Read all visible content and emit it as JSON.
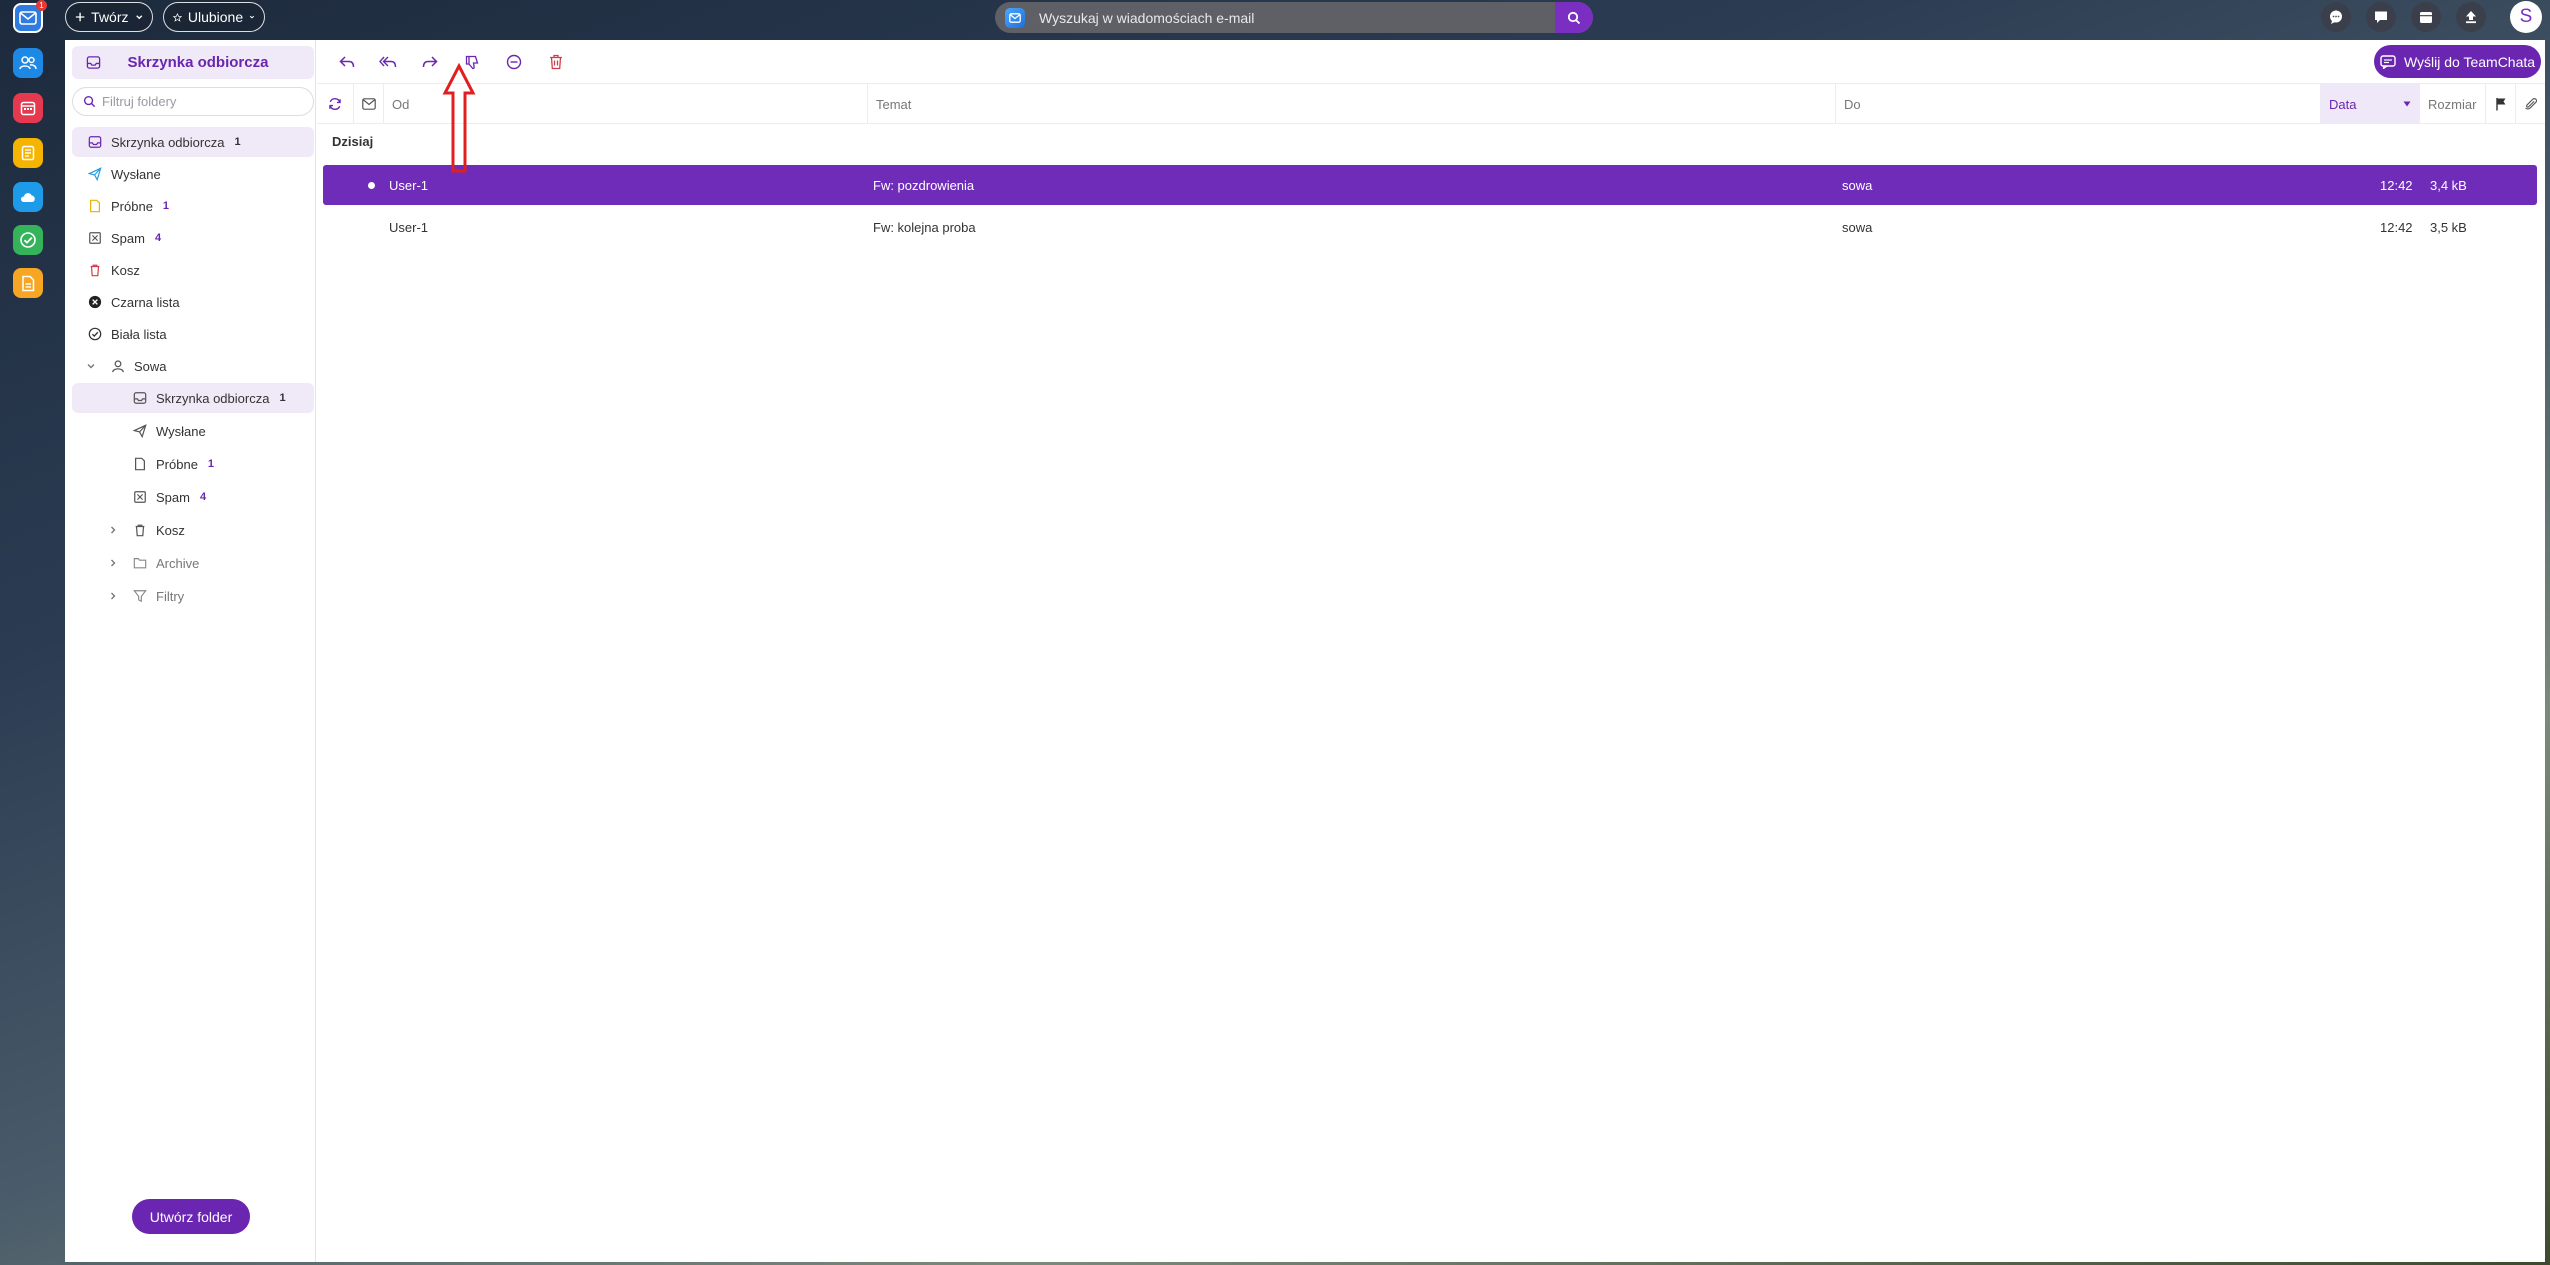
{
  "topbar": {
    "create_label": "Twórz",
    "favorites_label": "Ulubione",
    "search_placeholder": "Wyszukaj w wiadomościach e-mail",
    "avatar_letter": "S"
  },
  "dock": {
    "mail_badge": "1",
    "apps": [
      "mail-app-icon",
      "contacts-app-icon",
      "calendar-app-icon",
      "notes-app-icon",
      "cloud-app-icon",
      "tasks-app-icon",
      "documents-app-icon"
    ]
  },
  "sidebar": {
    "title": "Skrzynka odbiorcza",
    "filter_placeholder": "Filtruj foldery",
    "folders": [
      {
        "label": "Skrzynka odbiorcza",
        "count": "1"
      },
      {
        "label": "Wysłane",
        "count": ""
      },
      {
        "label": "Próbne",
        "count": "1"
      },
      {
        "label": "Spam",
        "count": "4"
      },
      {
        "label": "Kosz",
        "count": ""
      },
      {
        "label": "Czarna lista",
        "count": ""
      },
      {
        "label": "Biała lista",
        "count": ""
      }
    ],
    "account": {
      "label": "Sowa",
      "folders": [
        {
          "label": "Skrzynka odbiorcza",
          "count": "1"
        },
        {
          "label": "Wysłane",
          "count": ""
        },
        {
          "label": "Próbne",
          "count": "1"
        },
        {
          "label": "Spam",
          "count": "4"
        },
        {
          "label": "Kosz",
          "count": ""
        },
        {
          "label": "Archive",
          "count": ""
        },
        {
          "label": "Filtry",
          "count": ""
        }
      ]
    },
    "create_folder_label": "Utwórz folder"
  },
  "toolbar": {
    "send_teamchat_label": "Wyślij do TeamChata"
  },
  "columns": {
    "from": "Od",
    "subject": "Temat",
    "to": "Do",
    "date": "Data",
    "size": "Rozmiar"
  },
  "messages": {
    "group": "Dzisiaj",
    "rows": [
      {
        "from": "User-1",
        "subject": "Fw: pozdrowienia",
        "to": "sowa",
        "time": "12:42",
        "size": "3,4 kB"
      },
      {
        "from": "User-1",
        "subject": "Fw: kolejna proba",
        "to": "sowa",
        "time": "12:42",
        "size": "3,5 kB"
      }
    ]
  },
  "colors": {
    "accent": "#6a26b0",
    "selected_row": "#6f2cb8",
    "annotation": "#e02020"
  }
}
